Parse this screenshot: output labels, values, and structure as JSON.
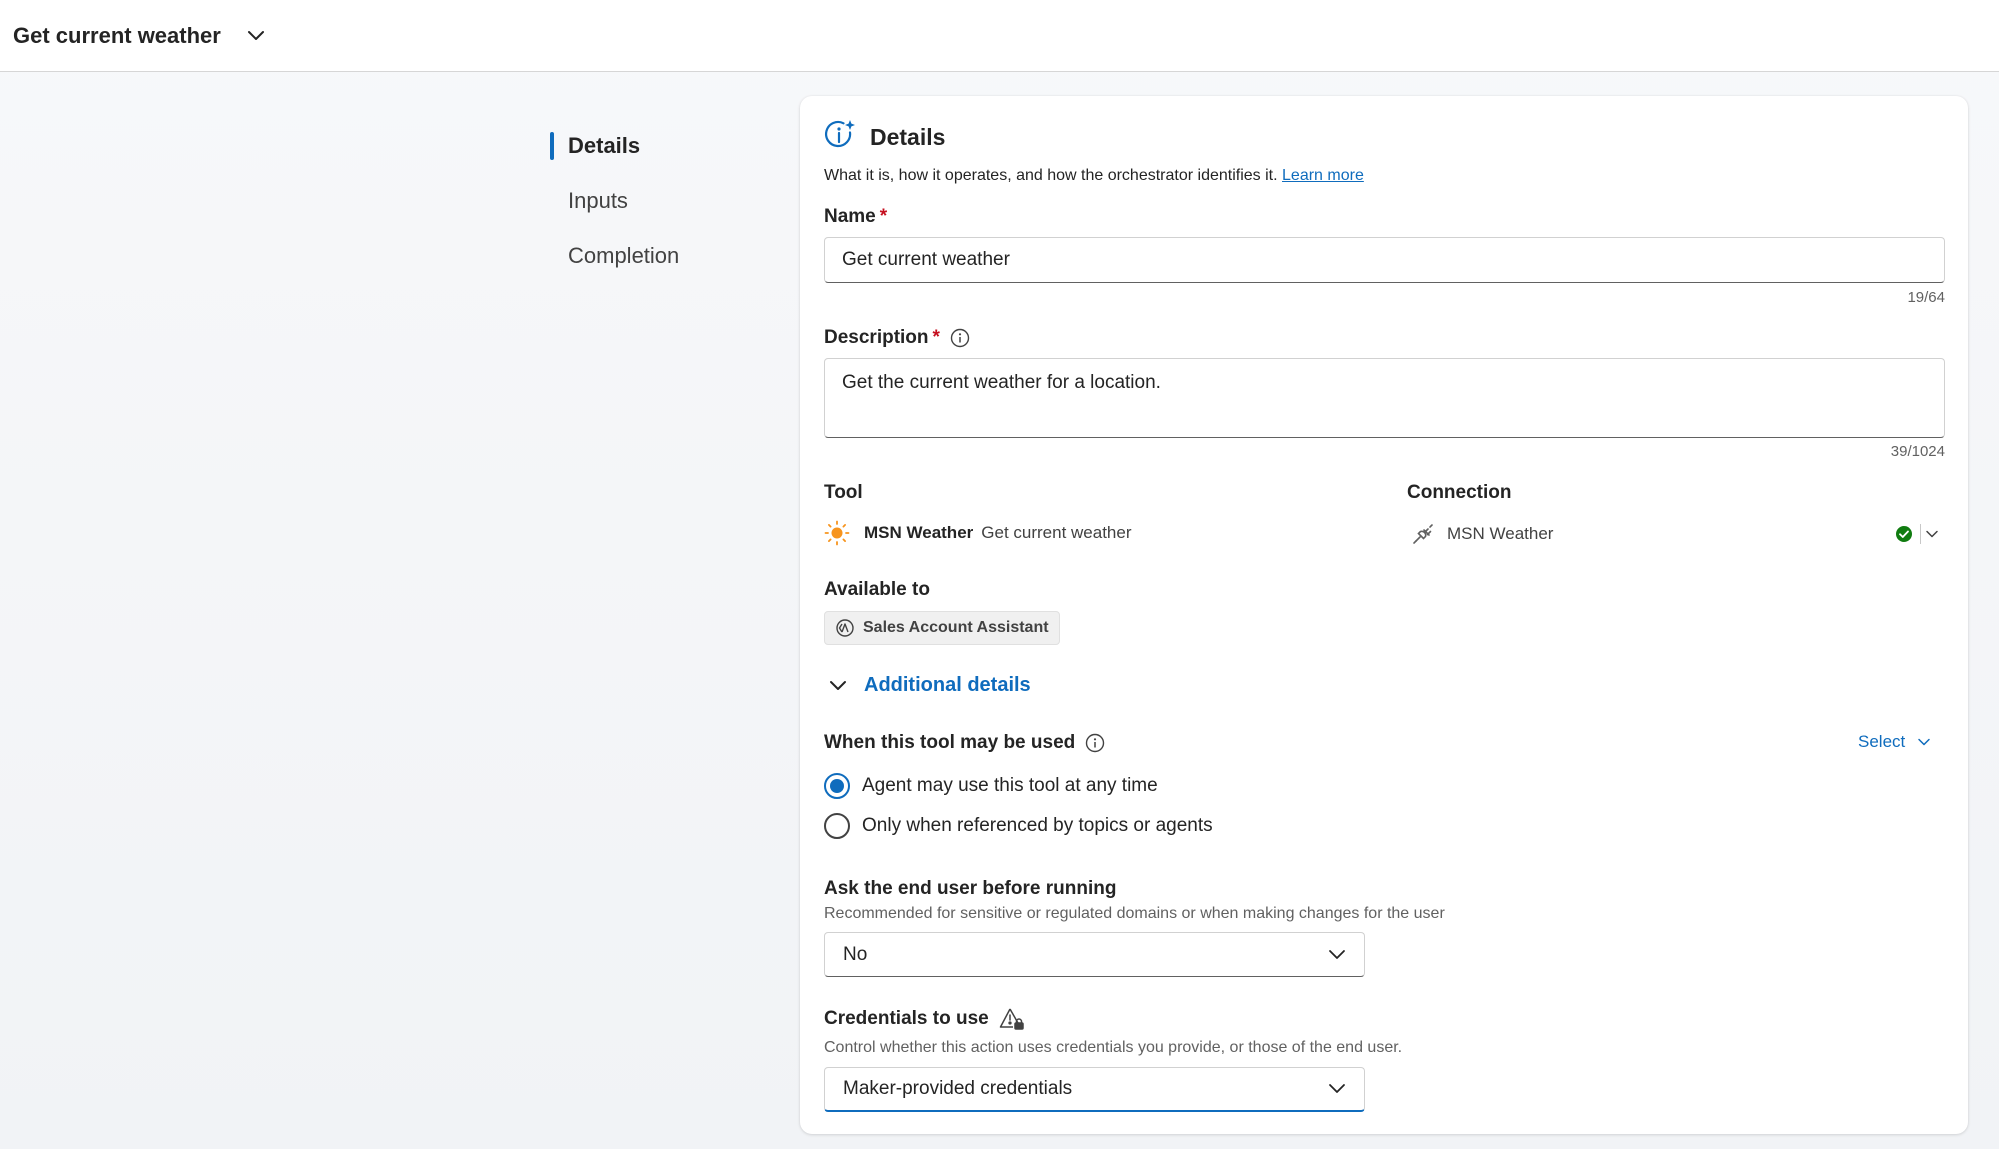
{
  "header": {
    "title": "Get current weather",
    "menu_icon": "chevron-down-icon"
  },
  "nav": {
    "items": [
      {
        "label": "Details",
        "active": true
      },
      {
        "label": "Inputs",
        "active": false
      },
      {
        "label": "Completion",
        "active": false
      }
    ]
  },
  "details": {
    "icon": "info-sparkle-icon",
    "title": "Details",
    "subtitle": "What it is, how it operates, and how the orchestrator identifies it.",
    "learn_more": "Learn more",
    "name": {
      "label": "Name",
      "required": "*",
      "value": "Get current weather",
      "counter": "19/64"
    },
    "description": {
      "label": "Description",
      "required": "*",
      "value": "Get the current weather for a location.",
      "counter": "39/1024"
    },
    "tool": {
      "label": "Tool",
      "icon": "sun-icon",
      "name": "MSN Weather",
      "action": "Get current weather"
    },
    "connection": {
      "label": "Connection",
      "icon": "plug-icon",
      "value": "MSN Weather",
      "status_icon": "check-circle-icon",
      "status_color": "#107c10"
    },
    "available_to": {
      "label": "Available to",
      "chip_icon": "agent-icon",
      "chip": "Sales Account Assistant"
    },
    "additional_details": {
      "label": "Additional details",
      "expanded": true
    },
    "when_used": {
      "label": "When this tool may be used",
      "select_label": "Select",
      "options": [
        {
          "label": "Agent may use this tool at any time",
          "checked": true
        },
        {
          "label": "Only when referenced by topics or agents",
          "checked": false
        }
      ]
    },
    "ask_user": {
      "label": "Ask the end user before running",
      "hint": "Recommended for sensitive or regulated domains or when making changes for the user",
      "value": "No"
    },
    "credentials": {
      "label": "Credentials to use",
      "hint": "Control whether this action uses credentials you provide, or those of the end user.",
      "value": "Maker-provided credentials"
    }
  },
  "colors": {
    "accent": "#0f6cbd",
    "link": "#0f6cbd",
    "required": "#c50f1f",
    "success": "#107c10",
    "sun": "#f7941d"
  }
}
